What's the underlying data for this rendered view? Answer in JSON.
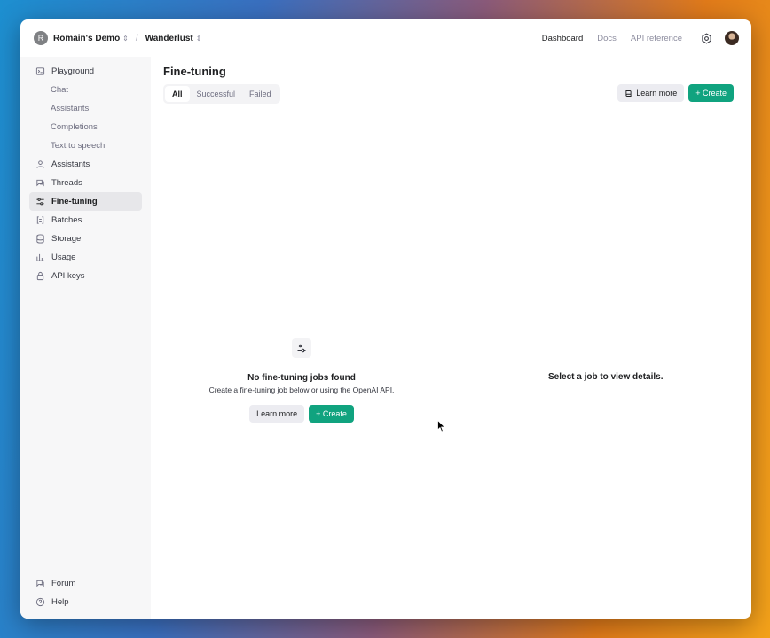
{
  "topbar": {
    "org_initial": "R",
    "org_name": "Romain's Demo",
    "project_name": "Wanderlust",
    "nav": [
      {
        "label": "Dashboard",
        "active": true
      },
      {
        "label": "Docs",
        "active": false
      },
      {
        "label": "API reference",
        "active": false
      }
    ]
  },
  "sidebar": {
    "items": [
      {
        "label": "Playground",
        "icon": "terminal-icon"
      },
      {
        "label": "Chat",
        "sub": true
      },
      {
        "label": "Assistants",
        "sub": true
      },
      {
        "label": "Completions",
        "sub": true
      },
      {
        "label": "Text to speech",
        "sub": true
      },
      {
        "label": "Assistants",
        "icon": "robot-icon"
      },
      {
        "label": "Threads",
        "icon": "threads-icon"
      },
      {
        "label": "Fine-tuning",
        "icon": "sliders-icon",
        "active": true
      },
      {
        "label": "Batches",
        "icon": "batches-icon"
      },
      {
        "label": "Storage",
        "icon": "database-icon"
      },
      {
        "label": "Usage",
        "icon": "chart-icon"
      },
      {
        "label": "API keys",
        "icon": "lock-icon"
      }
    ],
    "bottom": [
      {
        "label": "Forum",
        "icon": "forum-icon"
      },
      {
        "label": "Help",
        "icon": "help-icon"
      }
    ]
  },
  "main": {
    "title": "Fine-tuning",
    "filters": [
      {
        "label": "All",
        "active": true
      },
      {
        "label": "Successful",
        "active": false
      },
      {
        "label": "Failed",
        "active": false
      }
    ],
    "learn_more_label": "Learn more",
    "create_label": "+ Create",
    "empty": {
      "title": "No fine-tuning jobs found",
      "subtitle": "Create a fine-tuning job below or using the OpenAI API.",
      "learn_more_label": "Learn more",
      "create_label": "+ Create"
    },
    "detail_message": "Select a job to view details."
  },
  "colors": {
    "accent": "#10a37f",
    "sidebar_bg": "#f7f7f8",
    "active_item_bg": "#e7e7ea"
  }
}
